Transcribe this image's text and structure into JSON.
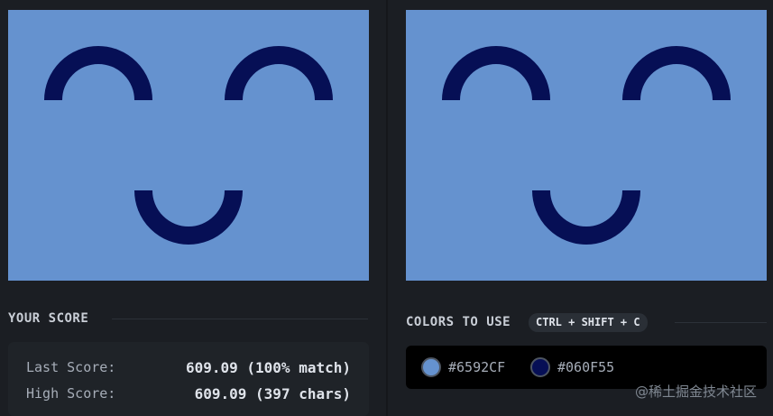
{
  "output": {
    "background": "#6592CF",
    "shape_color": "#060F55"
  },
  "target": {
    "background": "#6592CF",
    "shape_color": "#060F55"
  },
  "score": {
    "title": "YOUR SCORE",
    "last_label": "Last Score:",
    "last_value": "609.09 (100% match)",
    "high_label": "High Score:",
    "high_value": "609.09 (397 chars)"
  },
  "colors": {
    "title": "COLORS TO USE",
    "shortcut": "CTRL + SHIFT + C",
    "swatches": [
      {
        "hex": "#6592CF",
        "color": "#6592CF"
      },
      {
        "hex": "#060F55",
        "color": "#060F55"
      }
    ]
  },
  "watermark": "@稀土掘金技术社区"
}
